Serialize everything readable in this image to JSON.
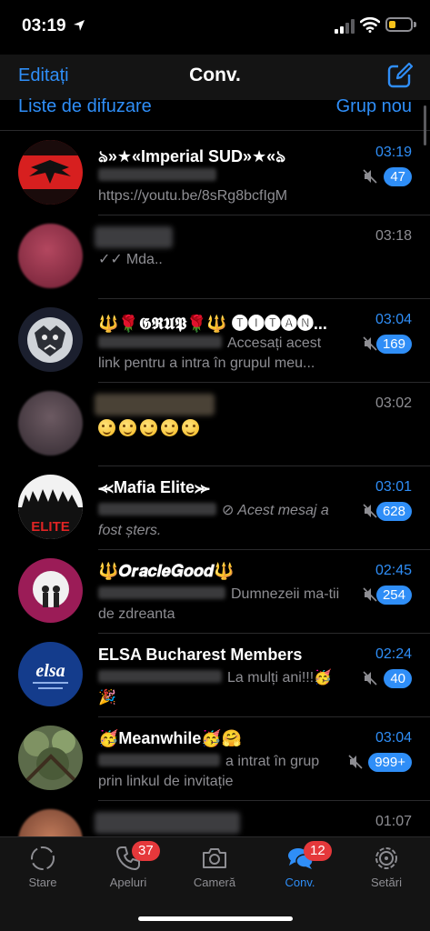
{
  "status_bar": {
    "time": "03:19",
    "battery_level": 0.3
  },
  "nav": {
    "edit_label": "Editați",
    "title": "Conv.",
    "broadcast_label": "Liste de difuzare",
    "new_group_label": "Grup nou"
  },
  "colors": {
    "accent": "#2f8ef7",
    "badge_red": "#e5383b",
    "background": "#000000",
    "bar": "#141414"
  },
  "chats": [
    {
      "name": "ঌ»★«Imperial SUD»★«ঌ",
      "time": "03:19",
      "preview": "https://youtu.be/8sRg8bcfIgM",
      "unread": "47",
      "muted": true
    },
    {
      "name": "",
      "time": "03:18",
      "preview": "Mda..",
      "read_ticks": "✓✓"
    },
    {
      "name": "🔱🌹𝕲𝕽𝖀𝕻🌹🔱 🅣🅘🅣🅐🅝...",
      "time": "03:04",
      "preview": "Accesați acest link pentru a intra în grupul meu...",
      "unread": "169",
      "muted": true
    },
    {
      "name": "",
      "time": "03:02",
      "preview_emoji": "😋😋😋😋😋"
    },
    {
      "name": "⪻Mafia Elite⪼",
      "time": "03:01",
      "preview": "Acest mesaj a fost șters.",
      "unread": "628",
      "muted": true
    },
    {
      "name": "🔱𝑶𝒓𝒂𝒄𝒍𝒆𝑮𝒐𝒐𝒅🔱",
      "time": "02:45",
      "preview": "Dumnezeii ma-tii de zdreanta",
      "unread": "254",
      "muted": true
    },
    {
      "name": "ELSA Bucharest Members",
      "time": "02:24",
      "preview": "La mulți ani!!!🥳🎉",
      "unread": "40",
      "muted": true
    },
    {
      "name": "🥳Meanwhile🥳🤗",
      "time": "03:04",
      "preview": "a intrat în grup prin linkul de invitație",
      "unread": "999+",
      "muted": true
    },
    {
      "name": "",
      "time": "01:07",
      "preview": ""
    }
  ],
  "tabs": [
    {
      "label": "Stare",
      "icon": "status-icon"
    },
    {
      "label": "Apeluri",
      "icon": "phone-icon",
      "badge": "37"
    },
    {
      "label": "Cameră",
      "icon": "camera-icon"
    },
    {
      "label": "Conv.",
      "icon": "chats-icon",
      "badge": "12",
      "active": true
    },
    {
      "label": "Setări",
      "icon": "gear-icon"
    }
  ]
}
